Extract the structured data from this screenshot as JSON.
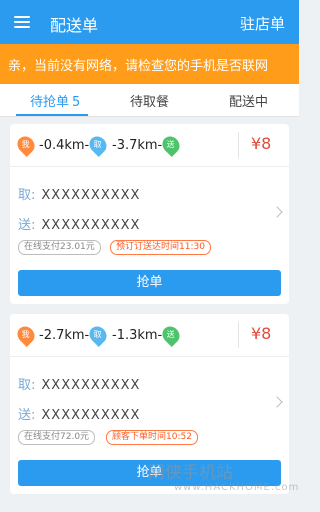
{
  "header": {
    "title": "配送单",
    "right_button": "驻店单",
    "icon": "menu-icon"
  },
  "alert": {
    "text": "亲，当前没有网络，请检查您的手机是否联网"
  },
  "tabs": [
    {
      "label": "待抢单",
      "count": "5"
    },
    {
      "label": "待取餐"
    },
    {
      "label": "配送中"
    }
  ],
  "orders": [
    {
      "me_marker": "我",
      "me_distance": "-0.4km-",
      "pickup_marker": "取",
      "pickup_distance": "-3.7km-",
      "drop_marker": "送",
      "price": "¥8",
      "pickup_label": "取:",
      "pickup_address": "XXXXXXXXXX",
      "drop_label": "送:",
      "drop_address": "XXXXXXXXXX",
      "pay_tag": "在线支付23.01元",
      "time_tag": "预订订送达时间11:30",
      "button": "抢单"
    },
    {
      "me_marker": "我",
      "me_distance": "-2.7km-",
      "pickup_marker": "取",
      "pickup_distance": "-1.3km-",
      "drop_marker": "送",
      "price": "¥8",
      "pickup_label": "取:",
      "pickup_address": "XXXXXXXXXX",
      "drop_label": "送:",
      "drop_address": "XXXXXXXXXX",
      "pay_tag": "在线支付72.0元",
      "time_tag": "顾客下单时间10:52",
      "button": "抢单"
    }
  ],
  "watermark": {
    "text": "网侠手机站",
    "sub": "www.HACKHOME.com"
  },
  "colors": {
    "primary": "#2a9bef",
    "alert": "#ff9c1a",
    "price": "#e44a3c",
    "me_pin": "#ff8a3d",
    "pickup_pin": "#58b9f0",
    "drop_pin": "#4fc36b"
  }
}
